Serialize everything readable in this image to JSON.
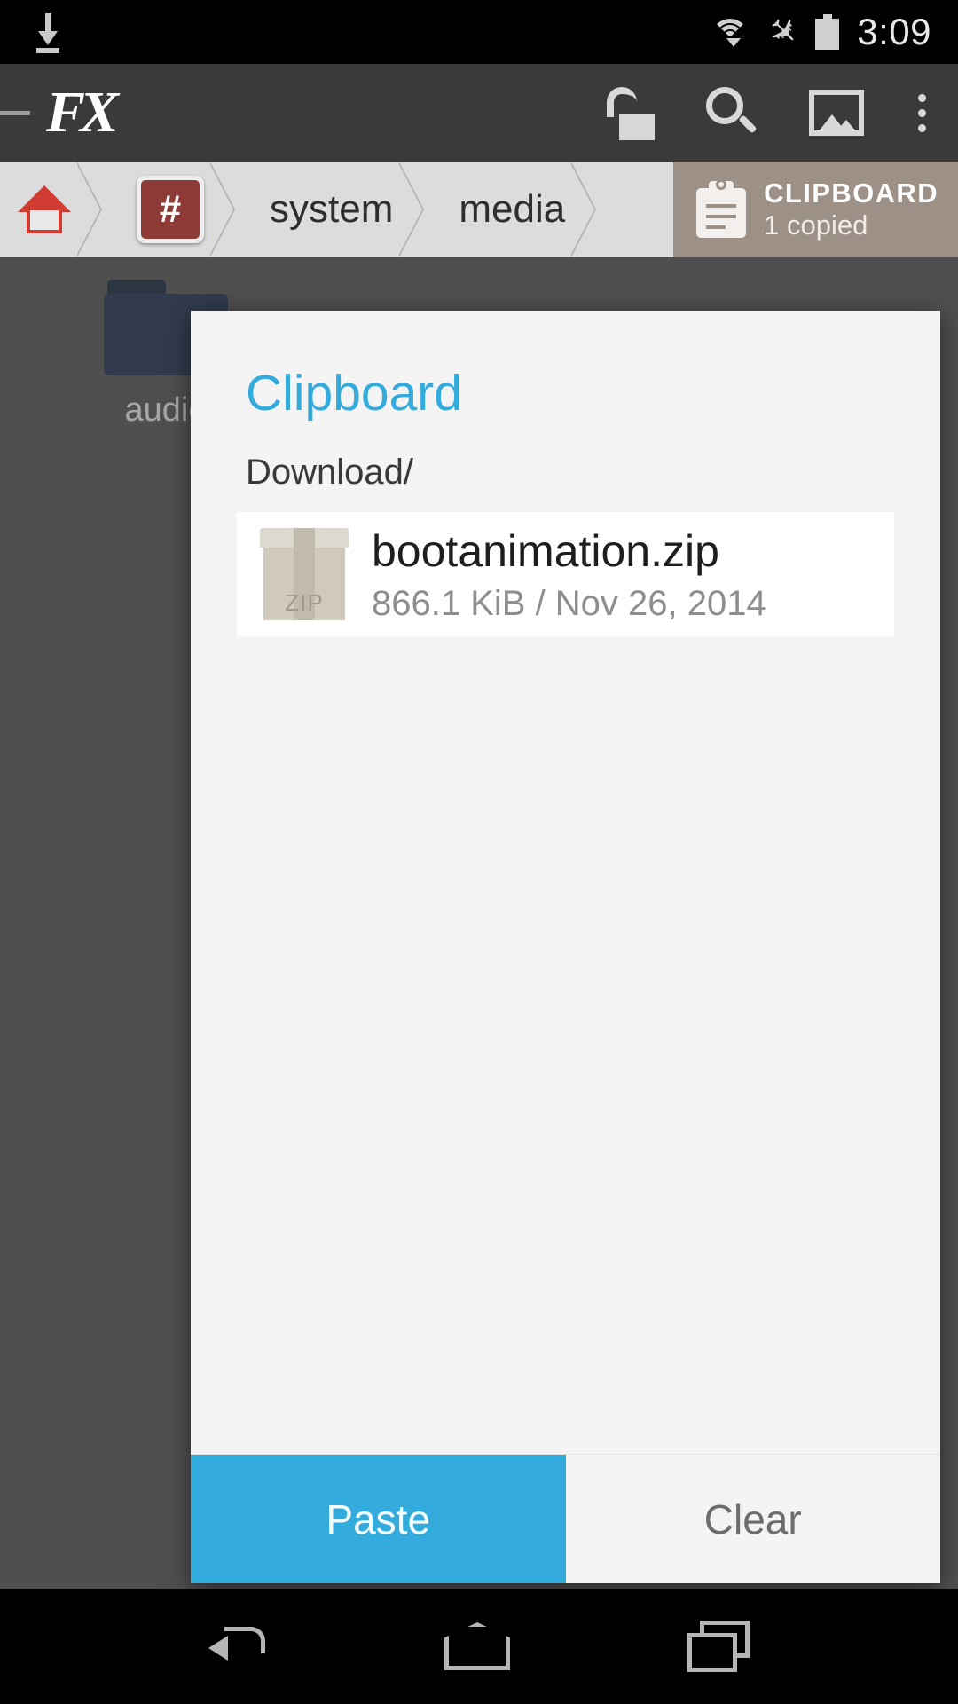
{
  "status_bar": {
    "download_icon": "download-icon",
    "wifi_icon": "wifi-icon",
    "airplane_icon": "airplane-mode-icon",
    "battery_icon": "battery-icon",
    "time": "3:09"
  },
  "app_bar": {
    "logo": "FX",
    "actions": [
      {
        "name": "unlock-icon",
        "label": "Unlock"
      },
      {
        "name": "search-icon",
        "label": "Search"
      },
      {
        "name": "gallery-icon",
        "label": "Gallery"
      },
      {
        "name": "overflow-menu-icon",
        "label": "More options"
      }
    ]
  },
  "breadcrumb": {
    "home_label": "Home",
    "root_label": "#",
    "crumbs": [
      "system",
      "media"
    ],
    "clipboard_chip": {
      "title": "CLIPBOARD",
      "subtitle": "1 copied"
    }
  },
  "background": {
    "folder_label": "audio"
  },
  "dialog": {
    "title": "Clipboard",
    "path": "Download/",
    "items": [
      {
        "icon": "zip-file-icon",
        "icon_label": "ZIP",
        "name": "bootanimation.zip",
        "details": "866.1 KiB / Nov 26, 2014"
      }
    ],
    "buttons": {
      "paste": "Paste",
      "clear": "Clear"
    }
  },
  "nav_bar": {
    "back": "back-icon",
    "home": "home-icon",
    "recents": "recents-icon"
  },
  "colors": {
    "accent": "#33acdd",
    "app_bar": "#3a3a3a",
    "clipboard_chip": "#9d9086",
    "breadcrumb": "#dcdcdc",
    "dialog": "#f4f4f4"
  }
}
